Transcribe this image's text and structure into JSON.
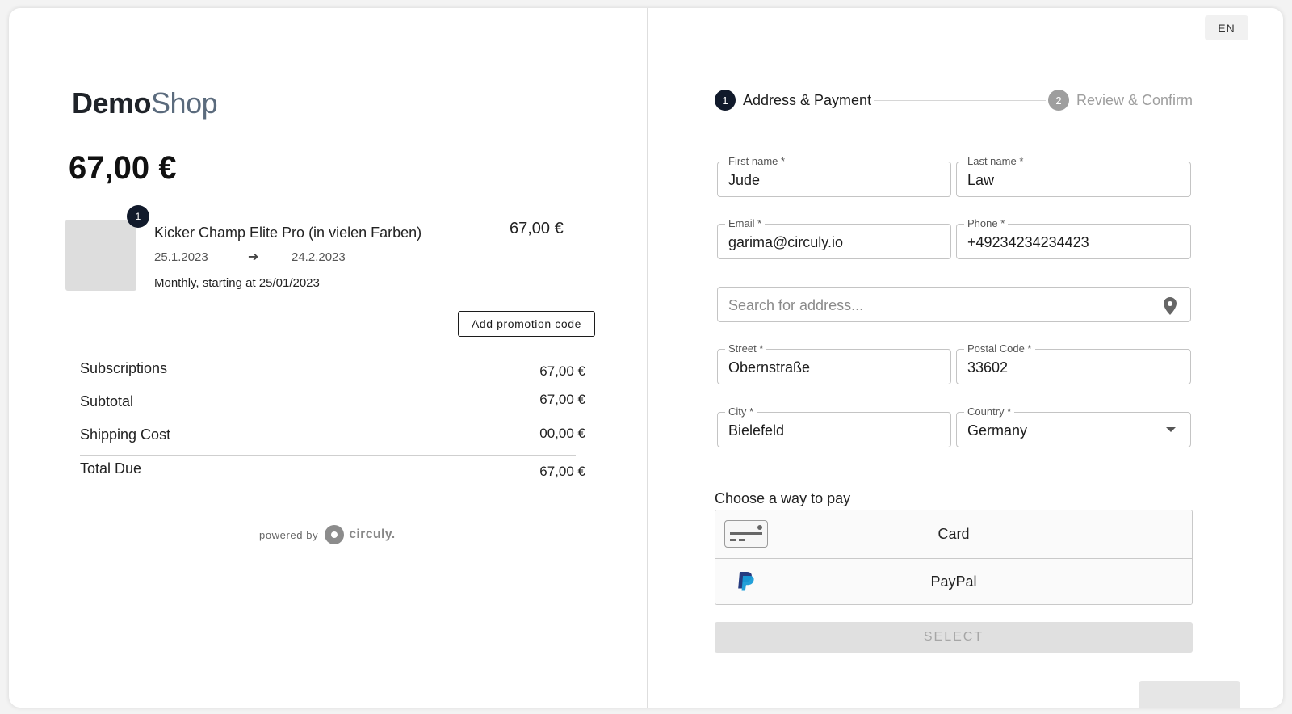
{
  "shop": {
    "logo_bold": "Demo",
    "logo_light": "Shop"
  },
  "order": {
    "total": "67,00 €",
    "item": {
      "quantity": "1",
      "name": "Kicker Champ Elite Pro (in vielen Farben)",
      "price": "67,00 €",
      "date_start": "25.1.2023",
      "date_end": "24.2.2023",
      "arrow": "➔",
      "billing_note": "Monthly, starting at 25/01/2023"
    },
    "promo_label": "Add promotion code",
    "summary": [
      {
        "label": "Subscriptions",
        "value": "67,00 €"
      },
      {
        "label": "Subtotal",
        "value": "67,00 €"
      },
      {
        "label": "Shipping Cost",
        "value": "00,00 €"
      },
      {
        "label": "Total Due",
        "value": "67,00 €"
      }
    ],
    "powered_by": "powered by",
    "powered_brand": "circuly."
  },
  "checkout": {
    "language": "EN",
    "steps": [
      {
        "number": "1",
        "label": "Address & Payment",
        "active": true
      },
      {
        "number": "2",
        "label": "Review & Confirm",
        "active": false
      }
    ],
    "fields": {
      "first_name": {
        "label": "First name *",
        "value": "Jude"
      },
      "last_name": {
        "label": "Last name *",
        "value": "Law"
      },
      "email": {
        "label": "Email *",
        "value": "garima@circuly.io"
      },
      "phone": {
        "label": "Phone *",
        "value": "+49234234234423"
      },
      "address_search": {
        "placeholder": "Search for address..."
      },
      "street": {
        "label": "Street *",
        "value": "Obernstraße"
      },
      "postal_code": {
        "label": "Postal Code *",
        "value": "33602"
      },
      "city": {
        "label": "City *",
        "value": "Bielefeld"
      },
      "country": {
        "label": "Country *",
        "value": "Germany"
      }
    },
    "payment": {
      "title": "Choose a way to pay",
      "options": [
        {
          "label": "Card",
          "icon": "credit-card-icon"
        },
        {
          "label": "PayPal",
          "icon": "paypal-icon"
        }
      ],
      "select_label": "SELECT"
    }
  },
  "colors": {
    "primary": "#111a2b",
    "inactive": "#9e9e9e",
    "paypal_dark": "#253b80",
    "paypal_light": "#179bd7"
  }
}
